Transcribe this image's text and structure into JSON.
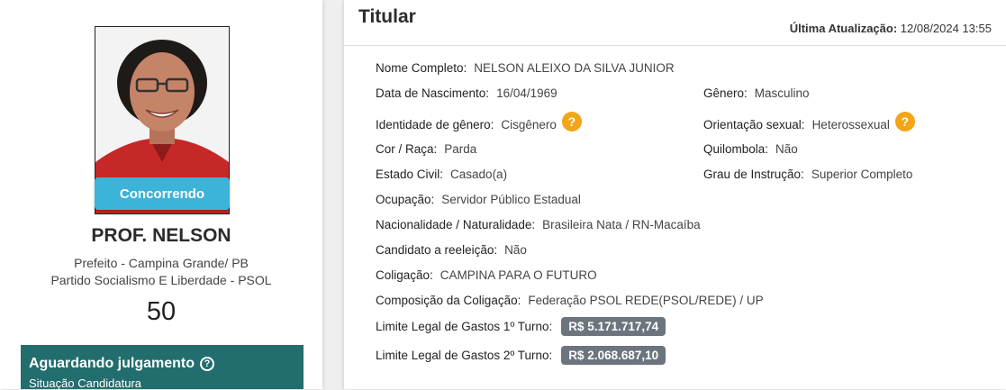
{
  "candidate": {
    "status_ribbon": "Concorrendo",
    "name": "PROF. NELSON",
    "office": "Prefeito - Campina Grande/ PB",
    "party": "Partido Socialismo E Liberdade - PSOL",
    "number": "50",
    "situation_title": "Aguardando julgamento",
    "situation_help": "?",
    "situation_sub": "Situação Candidatura"
  },
  "details": {
    "title": "Titular",
    "last_update_label": "Última Atualização:",
    "last_update_value": "12/08/2024 13:55",
    "fields": {
      "full_name": {
        "label": "Nome Completo:",
        "value": "NELSON ALEIXO DA SILVA JUNIOR"
      },
      "birth_date": {
        "label": "Data de Nascimento:",
        "value": "16/04/1969"
      },
      "gender": {
        "label": "Gênero:",
        "value": "Masculino"
      },
      "gender_identity": {
        "label": "Identidade de gênero:",
        "value": "Cisgênero"
      },
      "sexual_orientation": {
        "label": "Orientação sexual:",
        "value": "Heterossexual"
      },
      "race": {
        "label": "Cor / Raça:",
        "value": "Parda"
      },
      "quilombola": {
        "label": "Quilombola:",
        "value": "Não"
      },
      "marital_status": {
        "label": "Estado Civil:",
        "value": "Casado(a)"
      },
      "education": {
        "label": "Grau de Instrução:",
        "value": "Superior Completo"
      },
      "occupation": {
        "label": "Ocupação:",
        "value": "Servidor Público Estadual"
      },
      "nationality": {
        "label": "Nacionalidade / Naturalidade:",
        "value": "Brasileira Nata / RN-Macaíba"
      },
      "reelection": {
        "label": "Candidato a reeleição:",
        "value": "Não"
      },
      "coalition": {
        "label": "Coligação:",
        "value": "CAMPINA PARA O FUTURO"
      },
      "coalition_composition": {
        "label": "Composição da Coligação:",
        "value": "Federação PSOL REDE(PSOL/REDE) / UP"
      },
      "spending_limit_1": {
        "label": "Limite Legal de Gastos 1º Turno:",
        "value": "R$ 5.171.717,74"
      },
      "spending_limit_2": {
        "label": "Limite Legal de Gastos 2º Turno:",
        "value": "R$ 2.068.687,10"
      }
    },
    "help_glyph": "?"
  }
}
